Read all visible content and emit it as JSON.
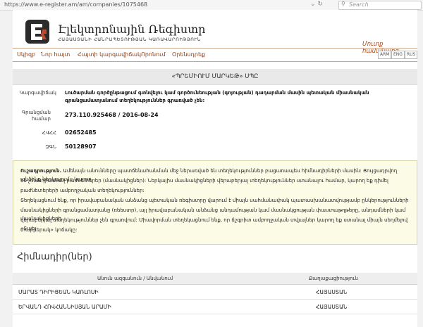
{
  "browser": {
    "url": "https://www.e-register.am/am/companies/1075468",
    "search_placeholder": "Search"
  },
  "header": {
    "site_title": "Էլեկտրոնային Ռեգիստր",
    "site_subtitle": "ՀԱՅԱՍՏԱՆԻ ՀԱՆՐԱՊԵՏՈՒԹՅԱՆ ԿԱՌԱՎԱՐՈՒԹՅՈՒՆ",
    "login_link": "Մուտք համակարգ"
  },
  "nav": {
    "items": [
      "Սկիզբ",
      "Նոր հայտ",
      "Հայտի կարգավիճակ",
      "Որոնում",
      "Օրենսդրեք"
    ],
    "languages": [
      "ARM",
      "ENG",
      "RUS"
    ]
  },
  "company": {
    "name": "«ՊՐԵՄԻՈՒՄ ՄԱՐԿԵԹ» ՍՊԸ",
    "fields": [
      {
        "label": "Կարգավիճակ",
        "value": "Լուծարման գործընթացում գտնվելու կամ գործունեության (գոյության) դադարման մասին պետական միասնական գրանցամատյանում տեղեկություններ գրառված չեն:"
      },
      {
        "label": "Գրանցման համար",
        "value": "273.110.925468 / 2016-08-24"
      },
      {
        "label": "ՀՎՀՀ",
        "value": "02652485"
      },
      {
        "label": "ԶԳՆ",
        "value": "50128907"
      }
    ]
  },
  "notice": {
    "heading": "Ուշադրություն.",
    "line1": "Ամենայն անունները պատճենահանման մեջ ներառված են տեղեկություններ բացառապես հիմնադիրների մասին: Ցույցադրվող անձինք ներկայումս կարող",
    "line2": "են չհանդիսանալ բաժնետերեր (մասնակիցներ): Ներկայիս մասնակիցների վերաբերյալ տեղեկություններ ստանալու համար, կարող եք դիմել",
    "line3": "բաժնետերերի ամբողջական տեղեկություններ:",
    "line4": "Տեղեկացնում ենք, որ իրավաբանական անձանց պետական ռեգիստրը վարում է միայն սահմանափակ պատասխանատվությամբ ընկերությունների",
    "line5": "մասնակիցների գրանցամատյանը (ռեեստր), այլ իրավաբանական անձանց անդամության կամ մասնակցության փաստաթղթերը, անդամների կամ մասնակիցների",
    "line6": "վերաբերյալ տեղեկություններ չեն գրառվում: Միավորման տեղեկացնում ենք, որ ճշգրիտ ամբողջական տվյալներ կարող եք ստանալ միայն սեղմելով «Տպել",
    "line7": "տարբերակ» կոճակը:"
  },
  "founders": {
    "title": "Հիմնադիր(ներ)",
    "col_name": "Անուն ազգանուն / Անվանում",
    "col_citizenship": "Քաղաքացիություն",
    "rows": [
      {
        "name": "ՄԱՐԱՏ ԴԻՐԻՑԵԱՆ ԿԱՌԼՈՍԻ",
        "citizenship": "ՀԱՅԱՍՏԱՆ"
      },
      {
        "name": "ԵՐՎԱՆԴ ՀՈՎՀԱՆՆԻՍՅԱՆ ԱՐԱՄԻ",
        "citizenship": "ՀԱՅԱՍՏԱՆ"
      }
    ]
  },
  "colors": {
    "accent": "#8a3b12",
    "notice_bg": "#fbfbe6",
    "title_bar_bg": "#e9e9e9"
  }
}
